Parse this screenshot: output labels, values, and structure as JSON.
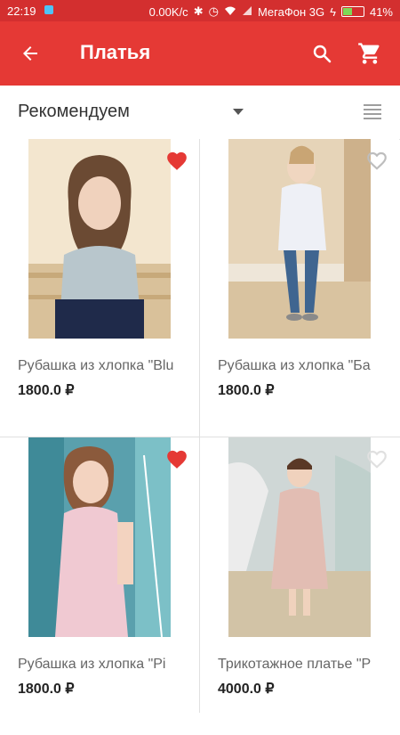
{
  "statusbar": {
    "time": "22:19",
    "net_speed": "0.00K/c",
    "carrier": "МегаФон 3G",
    "battery": "41%"
  },
  "appbar": {
    "title": "Платья"
  },
  "sort": {
    "label": "Рекомендуем"
  },
  "products": [
    {
      "name": "Рубашка из хлопка \"Blu",
      "price": "1800.0 ₽",
      "favorite": true
    },
    {
      "name": "Рубашка из хлопка \"Ба",
      "price": "1800.0 ₽",
      "favorite": false
    },
    {
      "name": "Рубашка из хлопка \"Pi",
      "price": "1800.0 ₽",
      "favorite": true
    },
    {
      "name": "Трикотажное платье \"Р",
      "price": "4000.0 ₽",
      "favorite": false
    }
  ],
  "colors": {
    "statusbar": "#d32f2f",
    "appbar": "#e53935",
    "heart_active": "#e53935",
    "heart_inactive": "#bdbdbd"
  }
}
